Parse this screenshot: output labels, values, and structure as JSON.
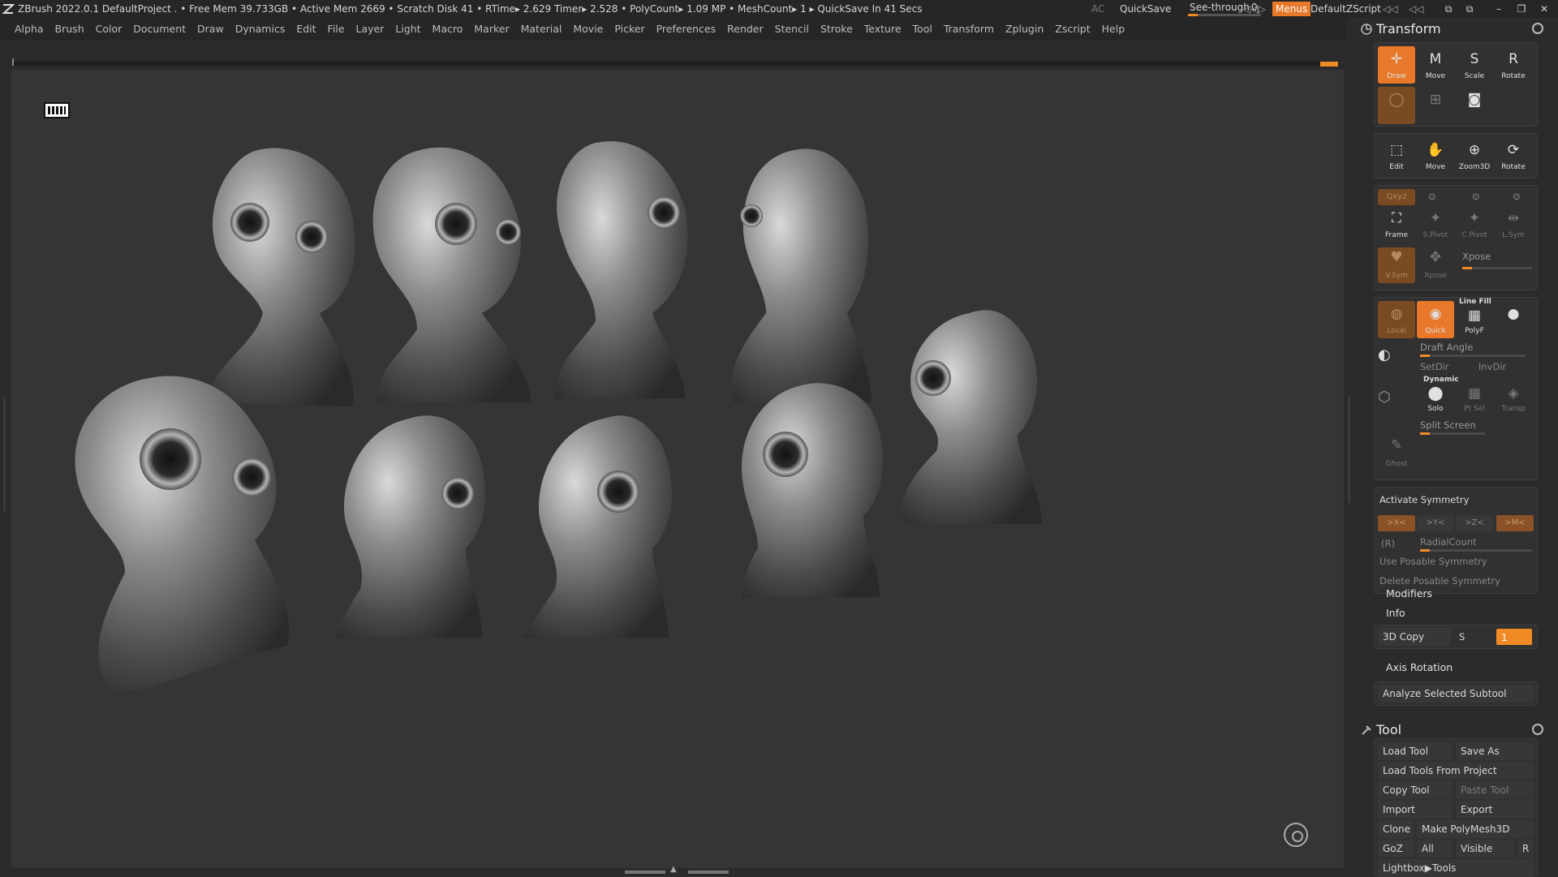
{
  "titlebar": {
    "status": "ZBrush 2022.0.1   DefaultProject   . • Free Mem 39.733GB • Active Mem 2669 • Scratch Disk 41 •  RTime▸ 2.629 Timer▸ 2.528 • PolyCount▸ 1.09 MP  • MeshCount▸ 1   ▸ QuickSave In 41 Secs",
    "ac": "AC",
    "quicksave": "QuickSave",
    "see_through_label": "See-through",
    "see_through_value": "0",
    "menus": "Menus",
    "script": "DefaultZScript"
  },
  "menubar": [
    "Alpha",
    "Brush",
    "Color",
    "Document",
    "Draw",
    "Dynamics",
    "Edit",
    "File",
    "Layer",
    "Light",
    "Macro",
    "Marker",
    "Material",
    "Movie",
    "Picker",
    "Preferences",
    "Render",
    "Stencil",
    "Stroke",
    "Texture",
    "Tool",
    "Transform",
    "Zplugin",
    "Zscript",
    "Help"
  ],
  "transform": {
    "title": "Transform",
    "draw": "Draw",
    "move": "Move",
    "scale": "Scale",
    "rotate": "Rotate",
    "edit": "Edit",
    "move2": "Move",
    "zoom3d": "Zoom3D",
    "rotate2": "Rotate",
    "frame": "Frame",
    "spivot": "S.Pivot",
    "cpivot": "C.Pivot",
    "lsym": "L.Sym",
    "xyz": "Qxyz",
    "vsym": "V.Sym",
    "xpose_btn": "Xpose",
    "xpose": "Xpose",
    "local": "Local",
    "quick": "Quick",
    "line_fill": "Line Fill",
    "polyf": "PolyF",
    "draft_angle": "Draft Angle",
    "setdir": "SetDir",
    "invdir": "InvDir",
    "dynamic": "Dynamic",
    "solo": "Solo",
    "ptsel": "Pt Sel",
    "transp": "Transp",
    "split_screen": "Split Screen",
    "ghost": "Ghost",
    "activate_symmetry": "Activate Symmetry",
    "sym_x": ">X<",
    "sym_y": ">Y<",
    "sym_z": ">Z<",
    "sym_m": ">M<",
    "r": "(R)",
    "radial_count": "RadialCount",
    "use_posable": "Use Posable Symmetry",
    "delete_posable": "Delete Posable Symmetry",
    "modifiers": "Modifiers",
    "info": "Info",
    "copy3d": "3D Copy",
    "copy_s": "S",
    "copy_val": "1",
    "axis_rotation": "Axis Rotation",
    "analyze": "Analyze Selected Subtool"
  },
  "tool": {
    "title": "Tool",
    "load_tool": "Load Tool",
    "save_as": "Save As",
    "load_from_project": "Load Tools From Project",
    "copy_tool": "Copy Tool",
    "paste_tool": "Paste Tool",
    "import": "Import",
    "export": "Export",
    "clone": "Clone",
    "make_polymesh": "Make PolyMesh3D",
    "goz": "GoZ",
    "all": "All",
    "visible": "Visible",
    "r": "R",
    "lightbox_tools": "Lightbox▶Tools"
  },
  "colors": {
    "accent": "#e8782a",
    "background": "#353535",
    "panel": "#2b2b2b"
  },
  "icons": [
    "zbrush-logo",
    "draw-icon",
    "move-icon",
    "scale-icon",
    "rotate-icon",
    "gyro-icon",
    "camera-icon",
    "reset-icon",
    "hammer-icon"
  ]
}
